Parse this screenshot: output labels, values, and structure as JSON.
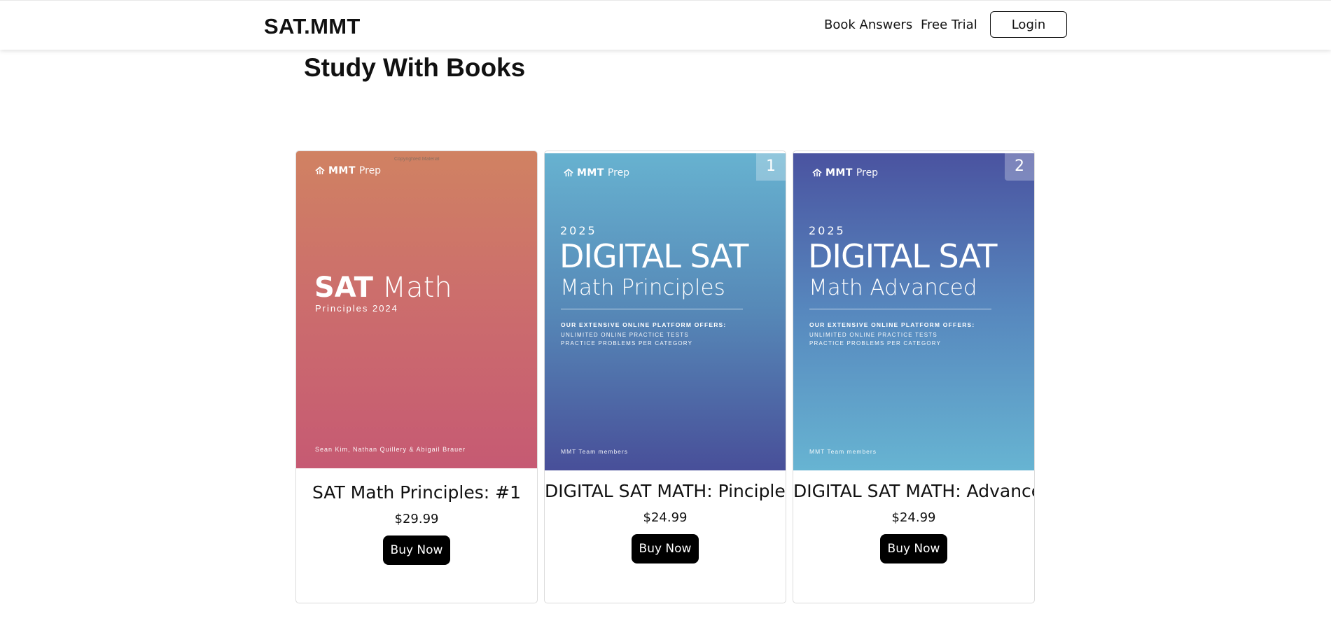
{
  "nav": {
    "brand": "SAT.MMT",
    "links": [
      {
        "label": "Book Answers"
      },
      {
        "label": "Free Trial"
      }
    ],
    "login_label": "Login"
  },
  "page": {
    "title": "Study With Books"
  },
  "books": [
    {
      "cover_color": "#d08262",
      "cover": {
        "logo_main": "MMT",
        "logo_sub": "Prep",
        "watermark": "Copyrighted Material",
        "title_bold": "SAT",
        "title_light": "Math",
        "subtitle": "Principles 2024",
        "authors": "Sean Kim, Nathan Quillery & Abigail Brauer"
      },
      "name": "SAT Math Principles: #1",
      "price": "$29.99",
      "buy_label": "Buy Now"
    },
    {
      "cover_color": "#67b2d0",
      "badge": "1",
      "cover": {
        "logo_main": "MMT",
        "logo_sub": "Prep",
        "year": "2025",
        "title": "DIGITAL SAT",
        "subtitle": "Math Principles",
        "offers_heading": "OUR EXTENSIVE ONLINE PLATFORM OFFERS:",
        "offer_1": "UNLIMITED ONLINE PRACTICE TESTS",
        "offer_2": "PRACTICE PROBLEMS PER CATEGORY",
        "team": "MMT Team members"
      },
      "name": "DIGITAL SAT MATH: Pinciples",
      "price": "$24.99",
      "buy_label": "Buy Now"
    },
    {
      "cover_color": "#4a53a0",
      "badge": "2",
      "cover": {
        "logo_main": "MMT",
        "logo_sub": "Prep",
        "year": "2025",
        "title": "DIGITAL SAT",
        "subtitle": "Math Advanced",
        "offers_heading": "OUR EXTENSIVE ONLINE PLATFORM OFFERS:",
        "offer_1": "UNLIMITED ONLINE PRACTICE TESTS",
        "offer_2": "PRACTICE PROBLEMS PER CATEGORY",
        "team": "MMT Team members"
      },
      "name": "DIGITAL SAT MATH: Advanced",
      "price": "$24.99",
      "buy_label": "Buy Now"
    }
  ]
}
